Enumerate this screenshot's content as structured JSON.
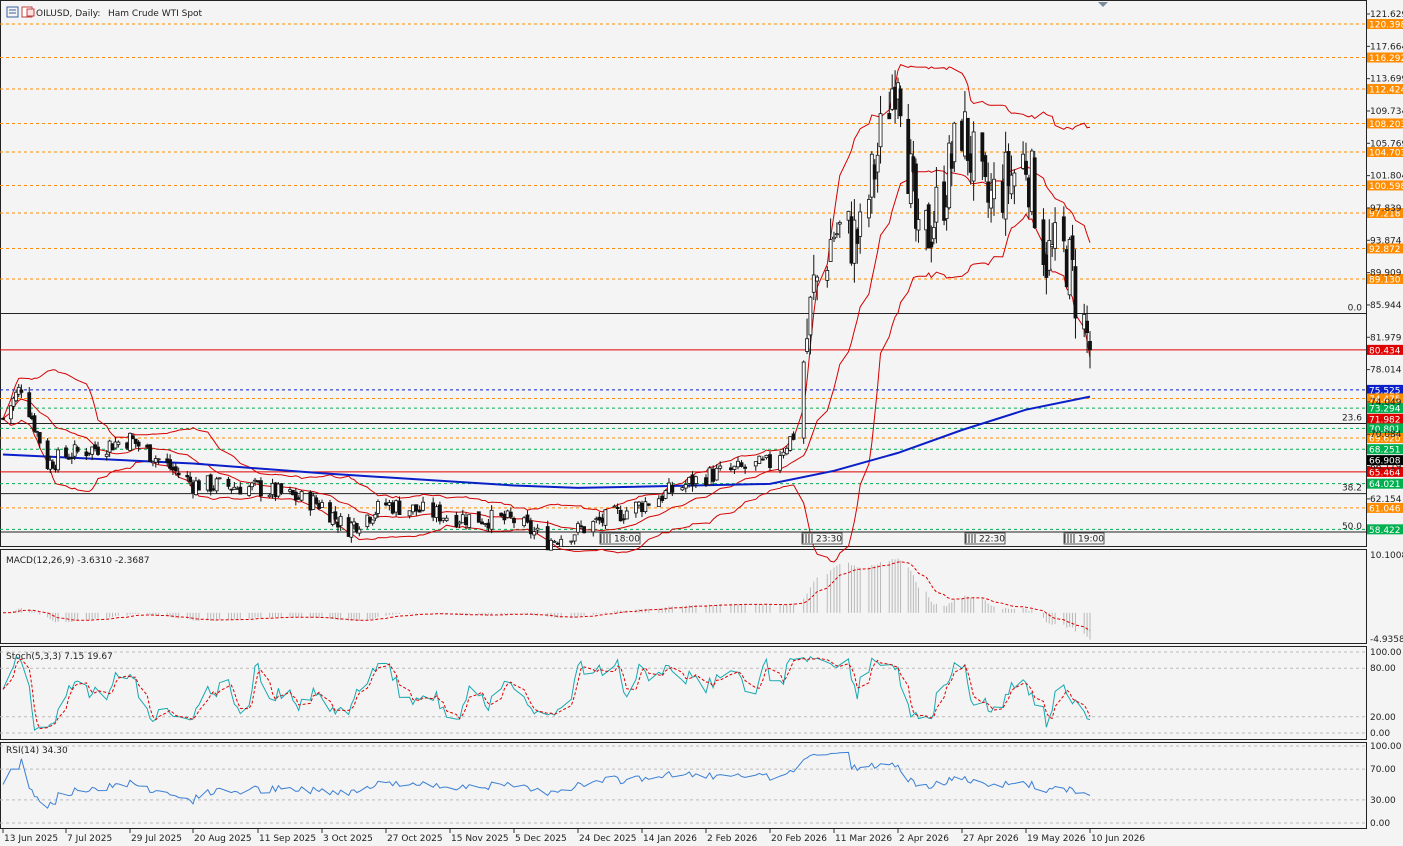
{
  "header": {
    "symbol": "OILUSD, Daily:",
    "desc": "Ham Crude WTI Spot"
  },
  "colors": {
    "background": "#f4f4f4",
    "bollinger": "#d40000",
    "ma200": "#0a1fc8",
    "orange_level": "#ff8c00",
    "green_level": "#00b050",
    "blue_level": "#0a1fc8",
    "current_price": "#e00000",
    "macd_signal": "#e00000",
    "stoch_main": "#18a8b0",
    "stoch_signal": "#e00000",
    "rsi": "#3a7fd5",
    "bull": "#ffffff",
    "bear": "#111111"
  },
  "price_axis": {
    "ticks": [
      "121.629",
      "117.664",
      "113.699",
      "109.734",
      "105.769",
      "101.804",
      "97.839",
      "93.874",
      "89.909",
      "85.944",
      "81.979",
      "78.014",
      "74.049",
      "70.084",
      "66.119",
      "62.154"
    ],
    "range": [
      56.5,
      121.629
    ],
    "level_tags": [
      {
        "label": "120.398",
        "value": 120.398,
        "bg": "#ff8c00",
        "line": "orange"
      },
      {
        "label": "116.292",
        "value": 116.292,
        "bg": "#ff8c00",
        "line": "orange"
      },
      {
        "label": "112.424",
        "value": 112.424,
        "bg": "#ff8c00",
        "line": "orange"
      },
      {
        "label": "108.203",
        "value": 108.203,
        "bg": "#ff8c00",
        "line": "orange"
      },
      {
        "label": "104.703",
        "value": 104.703,
        "bg": "#ff8c00",
        "line": "orange"
      },
      {
        "label": "100.598",
        "value": 100.598,
        "bg": "#ff8c00",
        "line": "orange"
      },
      {
        "label": "97.218",
        "value": 97.218,
        "bg": "#ff8c00",
        "line": "orange"
      },
      {
        "label": "92.872",
        "value": 92.872,
        "bg": "#ff8c00",
        "line": "orange"
      },
      {
        "label": "89.130",
        "value": 89.13,
        "bg": "#ff8c00",
        "line": "orange"
      },
      {
        "label": "80.434",
        "value": 80.434,
        "bg": "#e00000",
        "line": "red"
      },
      {
        "label": "75.525",
        "value": 75.525,
        "bg": "#0a1fc8",
        "line": "blue"
      },
      {
        "label": "74.475",
        "value": 74.475,
        "bg": "#ff8c00",
        "line": "orange"
      },
      {
        "label": "73.294",
        "value": 73.294,
        "bg": "#00b050",
        "line": "green"
      },
      {
        "label": "71.982",
        "value": 71.982,
        "bg": "#e00000",
        "line": "none"
      },
      {
        "label": "70.801",
        "value": 70.801,
        "bg": "#00b050",
        "line": "green"
      },
      {
        "label": "69.620",
        "value": 69.62,
        "bg": "#ff8c00",
        "line": "orange"
      },
      {
        "label": "68.251",
        "value": 68.251,
        "bg": "#00b050",
        "line": "green"
      },
      {
        "label": "66.908",
        "value": 66.908,
        "bg": "#000000",
        "line": "none"
      },
      {
        "label": "65.464",
        "value": 65.464,
        "bg": "#e00000",
        "line": "red"
      },
      {
        "label": "64.021",
        "value": 64.021,
        "bg": "#00b050",
        "line": "green"
      },
      {
        "label": "61.046",
        "value": 61.046,
        "bg": "#ff8c00",
        "line": "orange"
      },
      {
        "label": "58.422",
        "value": 58.422,
        "bg": "#00b050",
        "line": "green"
      }
    ]
  },
  "fibonacci": {
    "labels": [
      {
        "label": "0.0",
        "value": 84.9
      },
      {
        "label": "23.6",
        "value": 71.4
      },
      {
        "label": "38.2",
        "value": 62.8
      },
      {
        "label": "50.0",
        "value": 56.5
      }
    ]
  },
  "time_markers": [
    {
      "label": "18:00",
      "x": 628
    },
    {
      "label": "23:30",
      "x": 830
    },
    {
      "label": "22:30",
      "x": 993
    },
    {
      "label": "19:00",
      "x": 1092
    }
  ],
  "date_axis": {
    "labels": [
      "13 Jun 2025",
      "7 Jul 2025",
      "29 Jul 2025",
      "20 Aug 2025",
      "11 Sep 2025",
      "3 Oct 2025",
      "27 Oct 2025",
      "15 Nov 2025",
      "5 Dec 2025",
      "24 Dec 2025",
      "14 Jan 2026",
      "2 Feb 2026",
      "20 Feb 2026",
      "11 Mar 2026",
      "2 Apr 2026",
      "27 Apr 2026",
      "19 May 2026",
      "10 Jun 2026"
    ]
  },
  "macd": {
    "label": "MACD(12,26,9) -3.6310 -2.3687",
    "axis_max": "10.1008",
    "axis_min": "-4.9358",
    "range": [
      -4.9358,
      10.1008
    ]
  },
  "stoch": {
    "label": "Stoch(5,3,3) 7.15 19.67",
    "axis_labels": [
      "100.00",
      "80.00",
      "20.00",
      "0.00"
    ],
    "levels": [
      100,
      80,
      20,
      0
    ]
  },
  "rsi": {
    "label": "RSI(14) 34.30",
    "axis_labels": [
      "100.00",
      "70.00",
      "30.00",
      "0.00"
    ],
    "levels": [
      100,
      70,
      30,
      0
    ]
  },
  "chart_data": {
    "type": "candlestick",
    "title": "OILUSD, Daily: Ham Crude WTI Spot",
    "x_range": [
      "13 Jun 2025",
      "10 Jun 2026"
    ],
    "y_range": [
      56.5,
      121.629
    ],
    "current_price": 80.434,
    "anchors": [
      {
        "date": "13 Jun 2025",
        "close": 72.0
      },
      {
        "date": "20 Jun 2025",
        "close": 76.0
      },
      {
        "date": "30 Jun 2025",
        "close": 66.5
      },
      {
        "date": "7 Jul 2025",
        "close": 67.5
      },
      {
        "date": "29 Jul 2025",
        "close": 69.5
      },
      {
        "date": "20 Aug 2025",
        "close": 64.0
      },
      {
        "date": "11 Sep 2025",
        "close": 63.5
      },
      {
        "date": "3 Oct 2025",
        "close": 61.5
      },
      {
        "date": "12 Oct 2025",
        "close": 58.5
      },
      {
        "date": "27 Oct 2025",
        "close": 61.5
      },
      {
        "date": "15 Nov 2025",
        "close": 60.0
      },
      {
        "date": "5 Dec 2025",
        "close": 59.5
      },
      {
        "date": "15 Dec 2025",
        "close": 57.0
      },
      {
        "date": "24 Dec 2025",
        "close": 58.3
      },
      {
        "date": "14 Jan 2026",
        "close": 61.5
      },
      {
        "date": "2 Feb 2026",
        "close": 65.0
      },
      {
        "date": "20 Feb 2026",
        "close": 66.5
      },
      {
        "date": "27 Feb 2026",
        "close": 70.0
      },
      {
        "date": "5 Mar 2026",
        "close": 88.0
      },
      {
        "date": "11 Mar 2026",
        "close": 95.0
      },
      {
        "date": "20 Mar 2026",
        "close": 94.0
      },
      {
        "date": "28 Mar 2026",
        "close": 108.0
      },
      {
        "date": "2 Apr 2026",
        "close": 116.0
      },
      {
        "date": "10 Apr 2026",
        "close": 92.0
      },
      {
        "date": "20 Apr 2026",
        "close": 100.0
      },
      {
        "date": "27 Apr 2026",
        "close": 108.0
      },
      {
        "date": "5 May 2026",
        "close": 98.0
      },
      {
        "date": "19 May 2026",
        "close": 104.0
      },
      {
        "date": "26 May 2026",
        "close": 92.0
      },
      {
        "date": "2 Jun 2026",
        "close": 92.0
      },
      {
        "date": "10 Jun 2026",
        "close": 80.4
      }
    ],
    "ma200_anchors": [
      {
        "date": "13 Jun 2025",
        "value": 67.6
      },
      {
        "date": "20 Aug 2025",
        "value": 66.5
      },
      {
        "date": "3 Oct 2025",
        "value": 65.3
      },
      {
        "date": "5 Dec 2025",
        "value": 63.8
      },
      {
        "date": "24 Dec 2025",
        "value": 63.5
      },
      {
        "date": "20 Feb 2026",
        "value": 64.0
      },
      {
        "date": "11 Mar 2026",
        "value": 65.6
      },
      {
        "date": "2 Apr 2026",
        "value": 67.8
      },
      {
        "date": "27 Apr 2026",
        "value": 70.6
      },
      {
        "date": "19 May 2026",
        "value": 73.1
      },
      {
        "date": "10 Jun 2026",
        "value": 74.7
      }
    ]
  }
}
